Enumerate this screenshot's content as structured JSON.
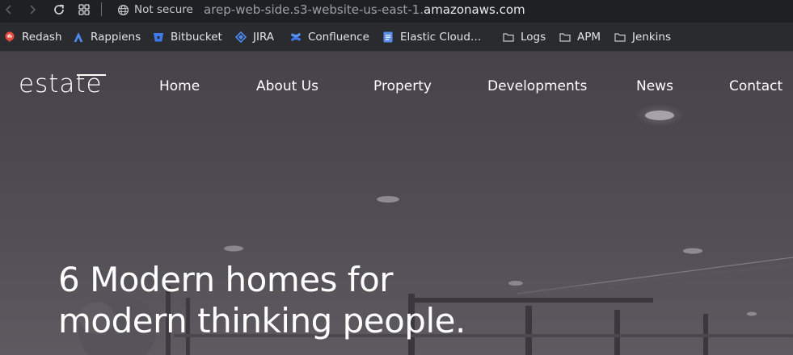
{
  "browser": {
    "security_label": "Not secure",
    "url_subdomain": "arep-web-side.s3-website-us-east-1.",
    "url_domain": "amazonaws.com",
    "bookmarks": [
      {
        "label": "Redash",
        "icon": "redash-icon",
        "color": "#e94b3c"
      },
      {
        "label": "Rappiens",
        "icon": "atlassian-icon",
        "color": "#4c8cf5"
      },
      {
        "label": "Bitbucket",
        "icon": "bitbucket-icon",
        "color": "#3d7bf0"
      },
      {
        "label": "JIRA",
        "icon": "jira-icon",
        "color": "#4c8cf5"
      },
      {
        "label": "Confluence",
        "icon": "confluence-icon",
        "color": "#3d7bf0"
      },
      {
        "label": "Elastic Cloud…",
        "icon": "document-icon",
        "color": "#5b8def"
      },
      {
        "label": "Logs",
        "icon": "folder-icon",
        "color": "#c8c9cc"
      },
      {
        "label": "APM",
        "icon": "folder-icon",
        "color": "#c8c9cc"
      },
      {
        "label": "Jenkins",
        "icon": "folder-icon",
        "color": "#c8c9cc"
      }
    ]
  },
  "site": {
    "logo_parts": [
      "esta",
      "t",
      "e"
    ],
    "nav": [
      "Home",
      "About Us",
      "Property",
      "Developments",
      "News",
      "Contact"
    ],
    "headline": [
      "6 Modern homes for",
      "modern thinking people."
    ]
  }
}
